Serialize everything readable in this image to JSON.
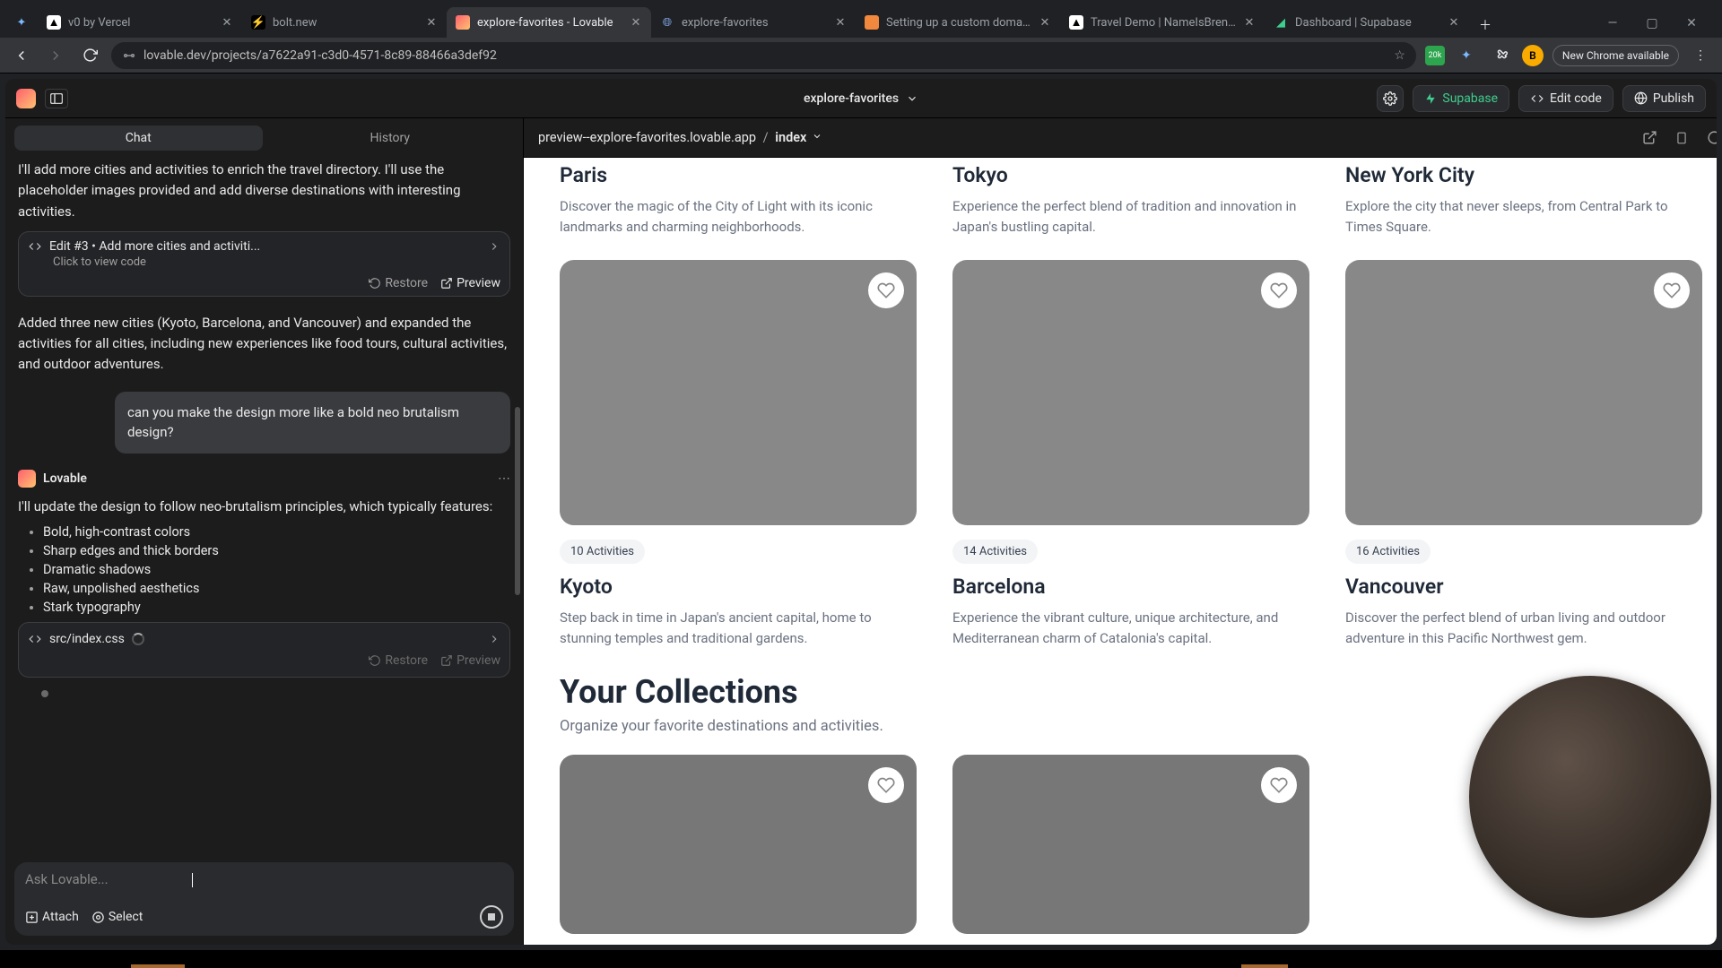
{
  "browser": {
    "tabs": [
      {
        "title": "",
        "pinned": true,
        "favicon": "sparkle"
      },
      {
        "title": "v0 by Vercel",
        "favicon": "triangle"
      },
      {
        "title": "bolt.new",
        "favicon": "bolt"
      },
      {
        "title": "explore-favorites - Lovable",
        "active": true,
        "favicon": "heart"
      },
      {
        "title": "explore-favorites",
        "favicon": "globe"
      },
      {
        "title": "Setting up a custom domain",
        "favicon": "doc"
      },
      {
        "title": "Travel Demo | NameIsBrenda",
        "favicon": "triangle"
      },
      {
        "title": "Dashboard | Supabase",
        "favicon": "supabase"
      }
    ],
    "url": "lovable.dev/projects/a7622a91-c3d0-4571-8c89-88466a3def92",
    "new_chrome_label": "New Chrome available",
    "avatar_initial": "B"
  },
  "app": {
    "project_name": "explore-favorites",
    "topbar": {
      "supabase": "Supabase",
      "edit_code": "Edit code",
      "publish": "Publish"
    }
  },
  "chat": {
    "tabs": {
      "chat": "Chat",
      "history": "History"
    },
    "msg1": "I'll add more cities and activities to enrich the travel directory. I'll use the placeholder images provided and add diverse destinations with interesting activities.",
    "edit3": {
      "title": "Edit #3 • Add more cities and activiti...",
      "hint": "Click to view code",
      "restore": "Restore",
      "preview": "Preview"
    },
    "msg2": "Added three new cities (Kyoto, Barcelona, and Vancouver) and expanded the activities for all cities, including new experiences like food tours, cultural activities, and outdoor adventures.",
    "user_msg": "can you make the design more like a bold neo brutalism design?",
    "assistant_name": "Lovable",
    "msg3": "I'll update the design to follow neo-brutalism principles, which typically features:",
    "bullets": [
      "Bold, high-contrast colors",
      "Sharp edges and thick borders",
      "Dramatic shadows",
      "Raw, unpolished aesthetics",
      "Stark typography"
    ],
    "file_card": {
      "path": "src/index.css",
      "restore": "Restore",
      "preview": "Preview"
    },
    "composer": {
      "placeholder": "Ask Lovable...",
      "attach": "Attach",
      "select": "Select"
    }
  },
  "preview": {
    "host": "preview--explore-favorites.lovable.app",
    "route": "index",
    "row1": [
      {
        "title": "Paris",
        "desc": "Discover the magic of the City of Light with its iconic landmarks and charming neighborhoods."
      },
      {
        "title": "Tokyo",
        "desc": "Experience the perfect blend of tradition and innovation in Japan's bustling capital."
      },
      {
        "title": "New York City",
        "desc": "Explore the city that never sleeps, from Central Park to Times Square."
      }
    ],
    "row2": [
      {
        "title": "Kyoto",
        "badge": "10 Activities",
        "desc": "Step back in time in Japan's ancient capital, home to stunning temples and traditional gardens."
      },
      {
        "title": "Barcelona",
        "badge": "14 Activities",
        "desc": "Experience the vibrant culture, unique architecture, and Mediterranean charm of Catalonia's capital."
      },
      {
        "title": "Vancouver",
        "badge": "16 Activities",
        "desc": "Discover the perfect blend of urban living and outdoor adventure in this Pacific Northwest gem."
      }
    ],
    "collections": {
      "heading": "Your Collections",
      "sub": "Organize your favorite destinations and activities."
    }
  }
}
